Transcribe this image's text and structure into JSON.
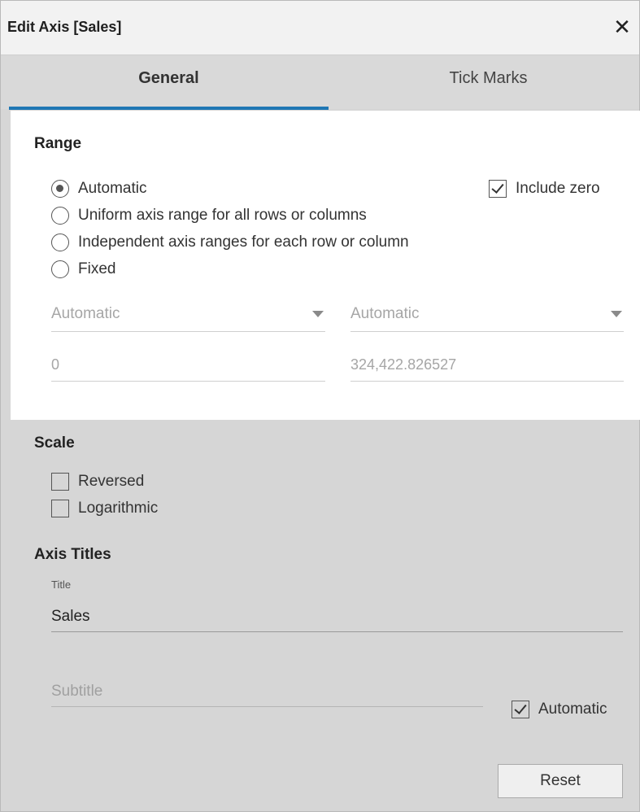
{
  "dialog": {
    "title": "Edit Axis [Sales]",
    "close_icon": "close-icon",
    "tabs": [
      {
        "label": "General",
        "active": true
      },
      {
        "label": "Tick Marks",
        "active": false
      }
    ],
    "accent_color": "#1f77b4"
  },
  "range": {
    "title": "Range",
    "options": [
      {
        "label": "Automatic",
        "selected": true
      },
      {
        "label": "Uniform axis range for all rows or columns",
        "selected": false
      },
      {
        "label": "Independent axis ranges for each row or column",
        "selected": false
      },
      {
        "label": "Fixed",
        "selected": false
      }
    ],
    "include_zero": {
      "label": "Include zero",
      "checked": true
    },
    "start_dropdown": "Automatic",
    "end_dropdown": "Automatic",
    "start_value": "0",
    "end_value": "324,422.826527"
  },
  "scale": {
    "title": "Scale",
    "reversed": {
      "label": "Reversed",
      "checked": false
    },
    "logarithmic": {
      "label": "Logarithmic",
      "checked": false
    }
  },
  "axis_titles": {
    "title": "Axis Titles",
    "title_label": "Title",
    "title_value": "Sales",
    "subtitle_placeholder": "Subtitle",
    "automatic": {
      "label": "Automatic",
      "checked": true
    }
  },
  "footer": {
    "reset_label": "Reset"
  }
}
